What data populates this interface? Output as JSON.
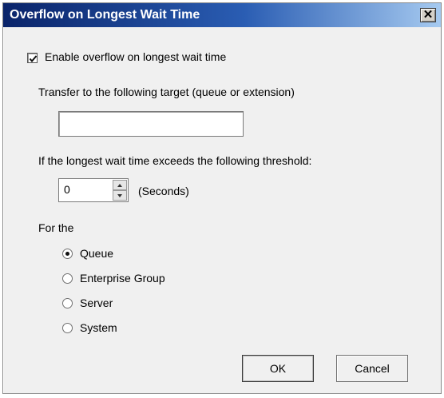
{
  "dialog": {
    "title": "Overflow on Longest Wait Time",
    "close_glyph": "✕"
  },
  "enable_overflow": {
    "label": "Enable overflow on longest wait time",
    "checked": true
  },
  "transfer": {
    "label": "Transfer to the following target (queue or extension)",
    "value": ""
  },
  "threshold": {
    "label": "If the longest wait time exceeds the following threshold:",
    "value": "0",
    "unit_label": "(Seconds)"
  },
  "scope": {
    "label": "For the",
    "options": [
      {
        "label": "Queue",
        "selected": true
      },
      {
        "label": "Enterprise Group",
        "selected": false
      },
      {
        "label": "Server",
        "selected": false
      },
      {
        "label": "System",
        "selected": false
      }
    ]
  },
  "buttons": {
    "ok": "OK",
    "cancel": "Cancel"
  }
}
